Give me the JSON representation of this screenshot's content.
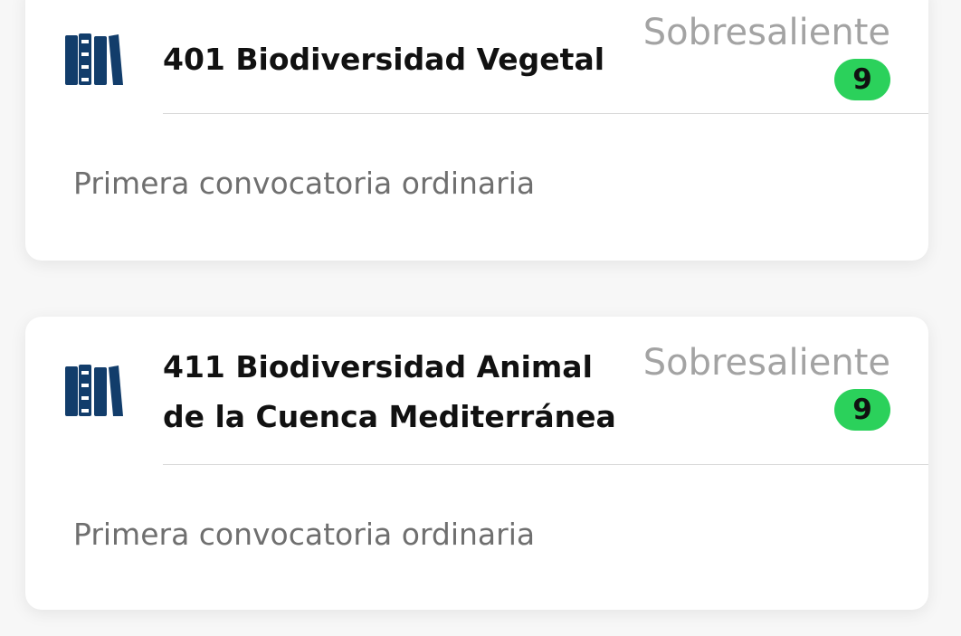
{
  "colors": {
    "icon": "#123d6b",
    "badge": "#2bd15b",
    "title": "#111111",
    "grade_label": "#a3a3a3",
    "subtitle": "#6f6f6f"
  },
  "courses": [
    {
      "icon": "book-shelf-icon",
      "title": "401 Biodiversidad Vegetal",
      "grade_label": "Sobresaliente",
      "grade_value": "9",
      "session": "Primera convocatoria ordinaria"
    },
    {
      "icon": "book-shelf-icon",
      "title": "411 Biodiversidad Animal de la Cuenca Mediterránea",
      "grade_label": "Sobresaliente",
      "grade_value": "9",
      "session": "Primera convocatoria ordinaria"
    }
  ]
}
